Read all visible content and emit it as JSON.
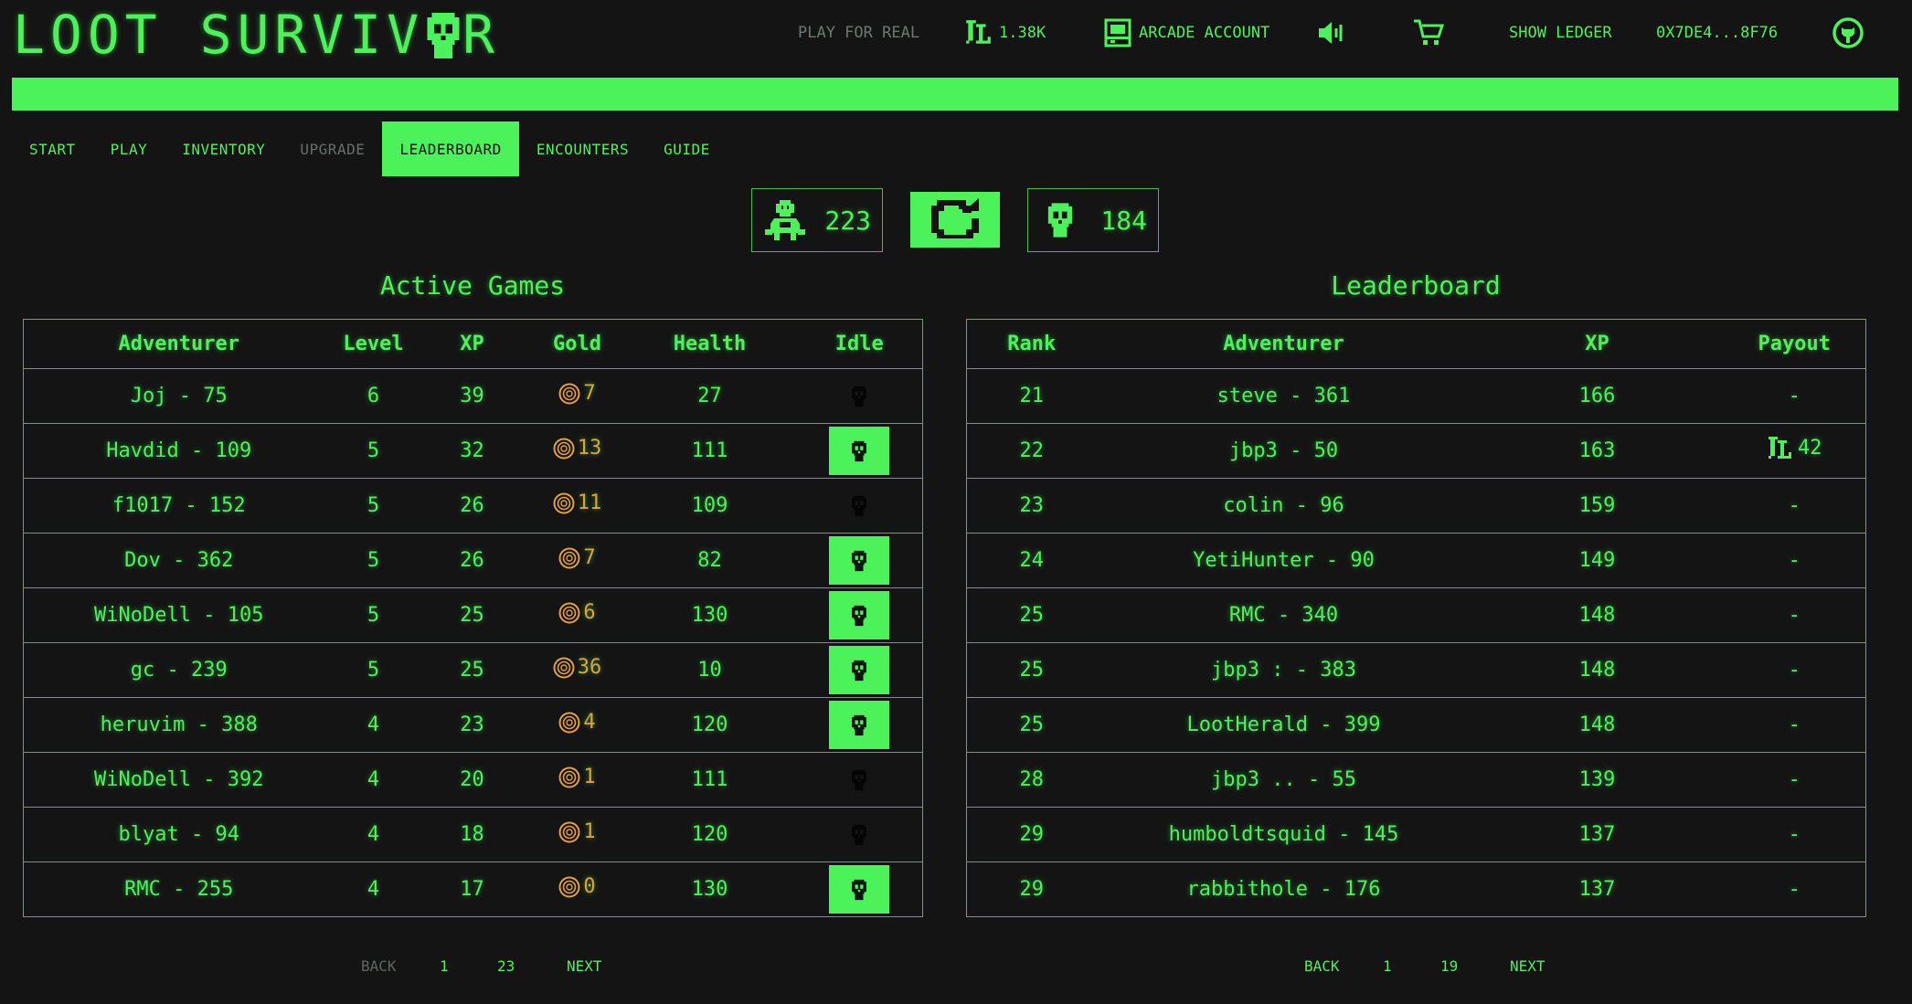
{
  "header": {
    "logo": "LOOT SURVIV",
    "logo_tail": "R",
    "play_for_real": "PLAY FOR REAL",
    "balance": "1.38K",
    "arcade_account": "ARCADE ACCOUNT",
    "show_ledger": "SHOW LEDGER",
    "address": "0X7DE4...8F76"
  },
  "nav": [
    "START",
    "PLAY",
    "INVENTORY",
    "UPGRADE",
    "LEADERBOARD",
    "ENCOUNTERS",
    "GUIDE"
  ],
  "stats": {
    "alive_count": "223",
    "dead_count": "184"
  },
  "active_games": {
    "title": "Active Games",
    "columns": [
      "Adventurer",
      "Level",
      "XP",
      "Gold",
      "Health",
      "Idle"
    ],
    "rows": [
      {
        "adventurer": "Joj - 75",
        "level": "6",
        "xp": "39",
        "gold": "7",
        "health": "27",
        "idle": false
      },
      {
        "adventurer": "Havdid - 109",
        "level": "5",
        "xp": "32",
        "gold": "13",
        "health": "111",
        "idle": true
      },
      {
        "adventurer": "f1017 - 152",
        "level": "5",
        "xp": "26",
        "gold": "11",
        "health": "109",
        "idle": false
      },
      {
        "adventurer": "Dov - 362",
        "level": "5",
        "xp": "26",
        "gold": "7",
        "health": "82",
        "idle": true
      },
      {
        "adventurer": "WiNoDell - 105",
        "level": "5",
        "xp": "25",
        "gold": "6",
        "health": "130",
        "idle": true
      },
      {
        "adventurer": "gc - 239",
        "level": "5",
        "xp": "25",
        "gold": "36",
        "health": "10",
        "idle": true
      },
      {
        "adventurer": "heruvim - 388",
        "level": "4",
        "xp": "23",
        "gold": "4",
        "health": "120",
        "idle": true
      },
      {
        "adventurer": "WiNoDell - 392",
        "level": "4",
        "xp": "20",
        "gold": "1",
        "health": "111",
        "idle": false
      },
      {
        "adventurer": "blyat - 94",
        "level": "4",
        "xp": "18",
        "gold": "1",
        "health": "120",
        "idle": false
      },
      {
        "adventurer": "RMC - 255",
        "level": "4",
        "xp": "17",
        "gold": "0",
        "health": "130",
        "idle": true
      }
    ],
    "pager": {
      "back": "BACK",
      "page": "1",
      "total": "23",
      "next": "NEXT"
    }
  },
  "leaderboard": {
    "title": "Leaderboard",
    "columns": [
      "Rank",
      "Adventurer",
      "XP",
      "Payout"
    ],
    "rows": [
      {
        "rank": "21",
        "adventurer": "steve - 361",
        "xp": "166",
        "payout": "-",
        "has_token": false
      },
      {
        "rank": "22",
        "adventurer": "jbp3 - 50",
        "xp": "163",
        "payout": "42",
        "has_token": true
      },
      {
        "rank": "23",
        "adventurer": "colin - 96",
        "xp": "159",
        "payout": "-",
        "has_token": false
      },
      {
        "rank": "24",
        "adventurer": "YetiHunter - 90",
        "xp": "149",
        "payout": "-",
        "has_token": false
      },
      {
        "rank": "25",
        "adventurer": "RMC - 340",
        "xp": "148",
        "payout": "-",
        "has_token": false
      },
      {
        "rank": "25",
        "adventurer": "jbp3 : - 383",
        "xp": "148",
        "payout": "-",
        "has_token": false
      },
      {
        "rank": "25",
        "adventurer": "LootHerald - 399",
        "xp": "148",
        "payout": "-",
        "has_token": false
      },
      {
        "rank": "28",
        "adventurer": "jbp3 .. - 55",
        "xp": "139",
        "payout": "-",
        "has_token": false
      },
      {
        "rank": "29",
        "adventurer": "humboldtsquid - 145",
        "xp": "137",
        "payout": "-",
        "has_token": false
      },
      {
        "rank": "29",
        "adventurer": "rabbithole - 176",
        "xp": "137",
        "payout": "-",
        "has_token": false
      }
    ],
    "pager": {
      "back": "BACK",
      "page": "1",
      "total": "19",
      "next": "NEXT"
    }
  },
  "colors": {
    "accent": "#4bf25a",
    "background": "#141414",
    "gold": "#e3a13b"
  }
}
